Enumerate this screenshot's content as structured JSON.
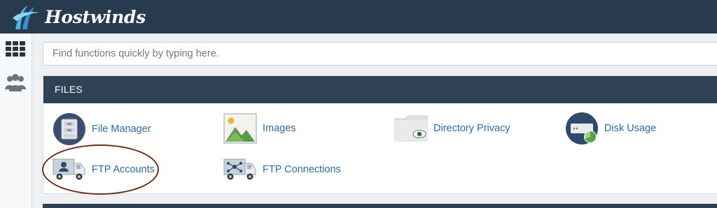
{
  "brand": {
    "name": "Hostwinds"
  },
  "sidebar": {
    "icons": [
      "apps-grid-icon",
      "users-icon"
    ]
  },
  "search": {
    "placeholder": "Find functions quickly by typing here."
  },
  "files_section": {
    "title": "FILES",
    "items": [
      {
        "label": "File Manager",
        "icon": "file-cabinet-icon"
      },
      {
        "label": "Images",
        "icon": "landscape-image-icon"
      },
      {
        "label": "Directory Privacy",
        "icon": "folder-eye-icon"
      },
      {
        "label": "Disk Usage",
        "icon": "disk-pie-icon"
      },
      {
        "label": "FTP Accounts",
        "icon": "ftp-truck-user-icon"
      },
      {
        "label": "FTP Connections",
        "icon": "ftp-truck-network-icon"
      }
    ]
  },
  "colors": {
    "topbar": "#283a4d",
    "panel_header": "#2f4256",
    "link": "#2e6aa6",
    "highlight_ring": "#6b2e1a"
  }
}
